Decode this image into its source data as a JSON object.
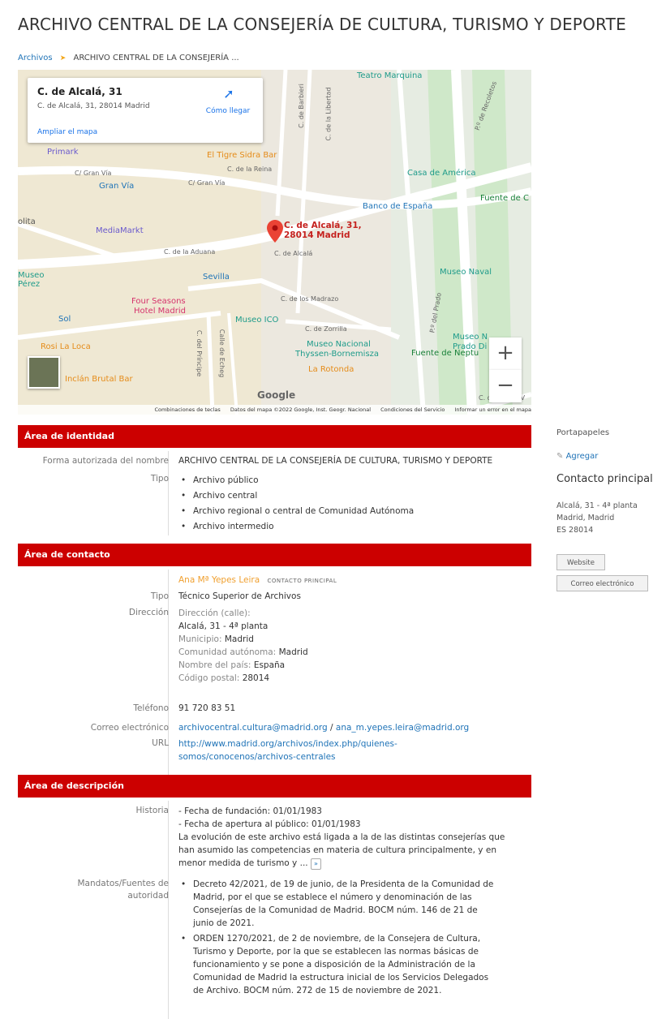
{
  "page": {
    "title": "ARCHIVO CENTRAL DE LA CONSEJERÍA DE CULTURA, TURISMO Y DEPORTE",
    "breadcrumb": [
      "Archivos",
      "ARCHIVO CENTRAL DE LA CONSEJERÍA ..."
    ]
  },
  "map": {
    "card_title": "C. de Alcalá, 31",
    "card_address": "C. de Alcalá, 31, 28014 Madrid",
    "directions_label": "Cómo llegar",
    "enlarge_label": "Ampliar el mapa",
    "pin_label_line1": "C. de Alcalá, 31,",
    "pin_label_line2": "28014 Madrid",
    "zoom_in": "+",
    "zoom_out": "−",
    "google_logo": "Google",
    "footer": [
      "Combinaciones de teclas",
      "Datos del mapa ©2022 Google, Inst. Geogr. Nacional",
      "Condiciones del Servicio",
      "Informar un error en el mapa"
    ],
    "places": [
      {
        "name": "Teatro Marquina",
        "color": "#1e9b8a"
      },
      {
        "name": "Primark",
        "color": "#6a5acd"
      },
      {
        "name": "El Tigre Sidra Bar",
        "color": "#e58c1a"
      },
      {
        "name": "Casa de América",
        "color": "#1e9b8a"
      },
      {
        "name": "Fuente de C",
        "color": "#188038"
      },
      {
        "name": "Banco de España",
        "color": "#1e73b7"
      },
      {
        "name": "MediaMarkt",
        "color": "#6a5acd"
      },
      {
        "name": "Sevilla",
        "color": "#1e73b7"
      },
      {
        "name": "Museo Naval",
        "color": "#1e9b8a"
      },
      {
        "name": "Four Seasons",
        "color": "#d6336c"
      },
      {
        "name": "Hotel Madrid",
        "color": "#d6336c"
      },
      {
        "name": "Sol",
        "color": "#1e73b7"
      },
      {
        "name": "Museo ICO",
        "color": "#1e9b8a"
      },
      {
        "name": "Rosi La Loca",
        "color": "#e58c1a"
      },
      {
        "name": "Museo Nacional",
        "color": "#1e9b8a"
      },
      {
        "name": "Thyssen-Bornemisza",
        "color": "#1e9b8a"
      },
      {
        "name": "Fuente de Neptu",
        "color": "#188038"
      },
      {
        "name": "La Rotonda",
        "color": "#e58c1a"
      },
      {
        "name": "Inclán Brutal Bar",
        "color": "#e58c1a"
      },
      {
        "name": "Museo N",
        "color": "#1e9b8a"
      },
      {
        "name": "Prado Di",
        "color": "#1e9b8a"
      },
      {
        "name": "Gran Vía",
        "color": "#1e73b7"
      },
      {
        "name": "Museo",
        "color": "#1e9b8a"
      },
      {
        "name": "Pérez",
        "color": "#1e9b8a"
      },
      {
        "name": "olita",
        "color": "#555"
      }
    ],
    "streets": [
      "C/ Gran Vía",
      "C/ Gran Vía",
      "C. de la Reina",
      "C. de la Aduana",
      "C. de Alcalá",
      "C. de los Madrazo",
      "C. de Zorrilla",
      "P.º del Prado",
      "C. del Príncipe",
      "Calle de Echeg",
      "C. de Barbieri",
      "C. de la Libertad",
      "P.º de Recoletos",
      "C. de Felipe IV"
    ]
  },
  "identity": {
    "header": "Área de identidad",
    "name_label": "Forma autorizada del nombre",
    "name_value": "ARCHIVO CENTRAL DE LA CONSEJERÍA DE CULTURA, TURISMO Y DEPORTE",
    "type_label": "Tipo",
    "types": [
      "Archivo público",
      "Archivo central",
      "Archivo regional o central de Comunidad Autónoma",
      "Archivo intermedio"
    ]
  },
  "contact": {
    "header": "Área de contacto",
    "person": "Ana Mª Yepes Leira",
    "primary_tag": "CONTACTO PRINCIPAL",
    "type_label": "Tipo",
    "type_value": "Técnico Superior de Archivos",
    "address_label": "Dirección",
    "street_label": "Dirección (calle):",
    "street_value": "Alcalá, 31 - 4ª planta",
    "municipality_label": "Municipio:",
    "municipality_value": "Madrid",
    "region_label": "Comunidad autónoma:",
    "region_value": "Madrid",
    "country_label": "Nombre del país:",
    "country_value": "España",
    "postal_label": "Código postal:",
    "postal_value": "28014",
    "phone_label": "Teléfono",
    "phone_value": "91 720 83 51",
    "email_label": "Correo electrónico",
    "email_1": "archivocentral.cultura@madrid.org",
    "email_sep": " / ",
    "email_2": "ana_m.yepes.leira@madrid.org",
    "url_label": "URL",
    "url_line1": "http://www.madrid.org/archivos/index.php/quienes-",
    "url_line2": "somos/conocenos/archivos-centrales"
  },
  "description": {
    "header": "Área de descripción",
    "history_label": "Historia",
    "history_lines": [
      "- Fecha de fundación: 01/01/1983",
      "- Fecha de apertura al público: 01/01/1983",
      "La evolución de este archivo está ligada a la de las distintas consejerías que",
      "han asumido las competencias en materia de cultura principalmente, y en",
      "menor medida de turismo y ..."
    ],
    "more_label": "»",
    "mandates_label_1": "Mandatos/Fuentes de",
    "mandates_label_2": "autoridad",
    "mandate_1": [
      "Decreto 42/2021, de 19 de junio, de la Presidenta de la Comunidad de",
      "Madrid, por el que se establece el número y denominación de las",
      "Consejerías de la Comunidad de Madrid. BOCM núm. 146 de 21 de",
      "junio de 2021."
    ],
    "mandate_2": [
      "ORDEN 1270/2021, de 2 de noviembre, de la Consejera de Cultura,",
      "Turismo y Deporte, por la que se establecen las normas básicas de",
      "funcionamiento y se pone a disposición de la Administración de la",
      "Comunidad de Madrid la estructura inicial de los Servicios Delegados",
      "de Archivo. BOCM núm. 272 de 15 de noviembre de 2021."
    ]
  },
  "sidebar": {
    "clipboard_title": "Portapapeles",
    "add_label": "Agregar",
    "contact_title": "Contacto principal",
    "address_lines": [
      "Alcalá, 31 - 4ª planta",
      "Madrid, Madrid",
      "ES 28014"
    ],
    "website_button": "Website",
    "email_button": "Correo electrónico"
  }
}
